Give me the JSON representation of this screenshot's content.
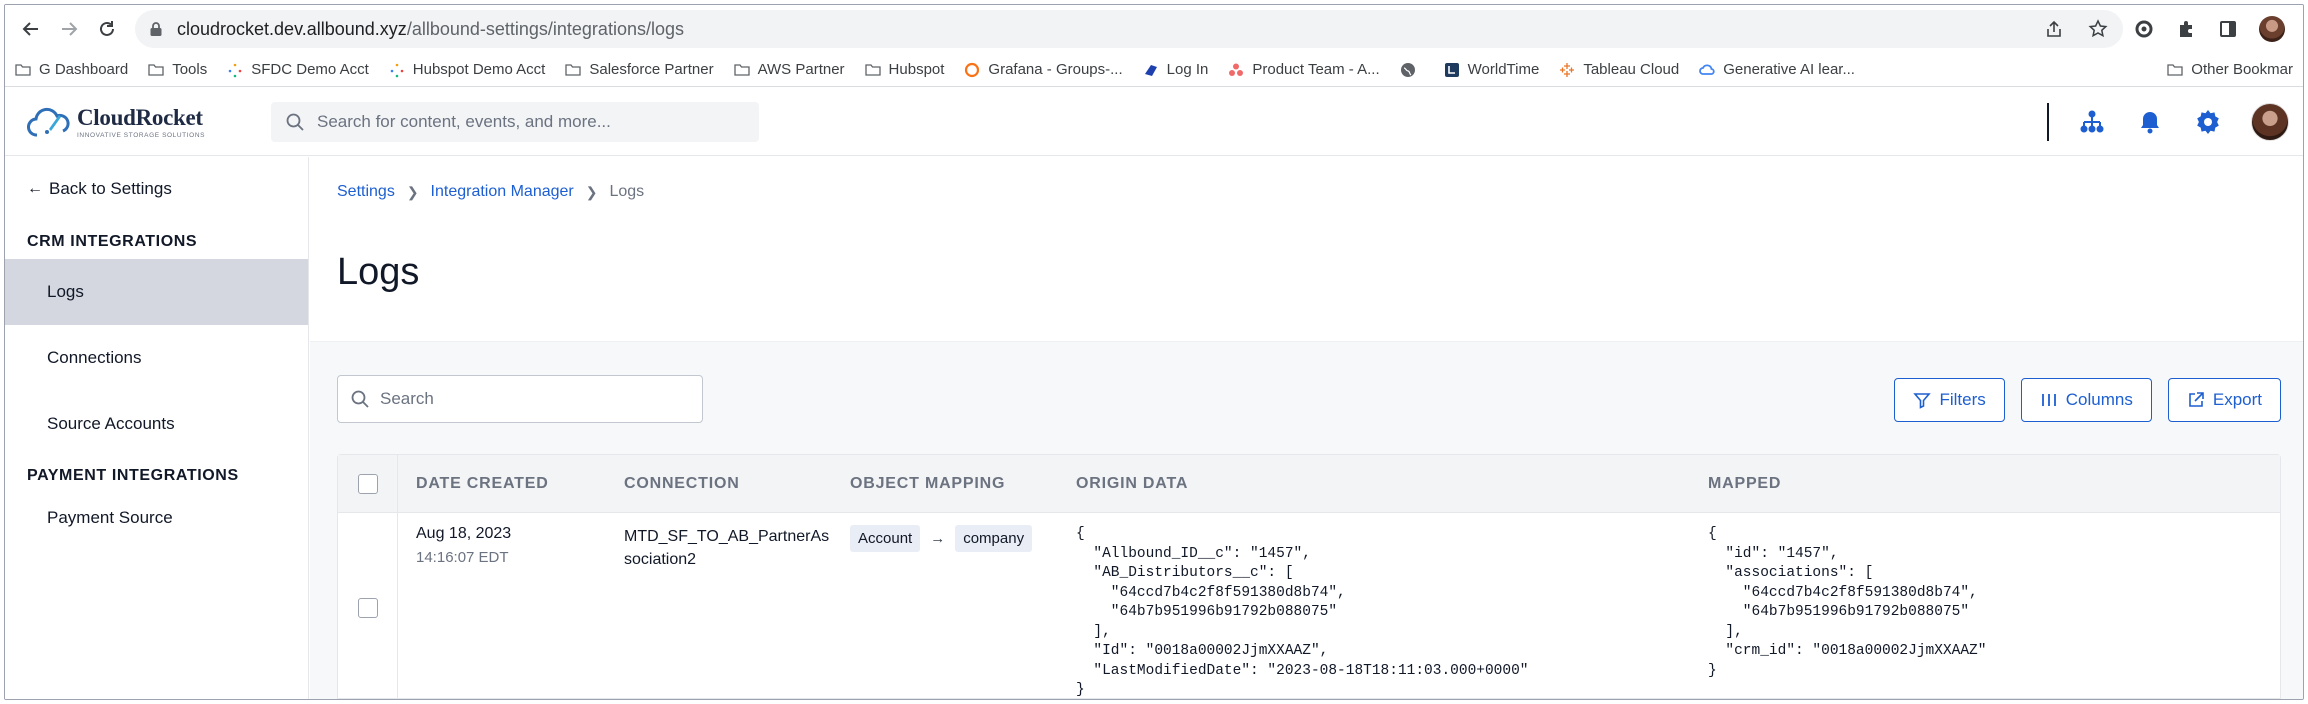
{
  "browser": {
    "url_host": "cloudrocket.dev.allbound.xyz",
    "url_path": "/allbound-settings/integrations/logs",
    "bookmarks": [
      {
        "label": "G Dashboard",
        "icon": "folder-icon"
      },
      {
        "label": "Tools",
        "icon": "folder-icon"
      },
      {
        "label": "SFDC Demo Acct",
        "icon": "sparkle-icon"
      },
      {
        "label": "Hubspot Demo Acct",
        "icon": "sparkle-icon"
      },
      {
        "label": "Salesforce Partner",
        "icon": "folder-icon"
      },
      {
        "label": "AWS Partner",
        "icon": "folder-icon"
      },
      {
        "label": "Hubspot",
        "icon": "folder-icon"
      },
      {
        "label": "Grafana - Groups-...",
        "icon": "grafana-icon"
      },
      {
        "label": "Log In",
        "icon": "login-icon"
      },
      {
        "label": "Product Team - A...",
        "icon": "asana-icon"
      },
      {
        "label": "",
        "icon": "globe-icon"
      },
      {
        "label": "WorldTime",
        "icon": "worldtime-icon"
      },
      {
        "label": "Tableau Cloud",
        "icon": "tableau-icon"
      },
      {
        "label": "Generative AI lear...",
        "icon": "google-cloud-icon"
      }
    ],
    "other_bookmarks": "Other Bookmar"
  },
  "header": {
    "brand_name": "CloudRocket",
    "brand_tagline": "INNOVATIVE STORAGE SOLUTIONS",
    "search_placeholder": "Search for content, events, and more..."
  },
  "sidebar": {
    "back_label": "Back to Settings",
    "crm_title": "CRM INTEGRATIONS",
    "crm_items": [
      "Logs",
      "Connections",
      "Source Accounts"
    ],
    "payment_title": "PAYMENT INTEGRATIONS",
    "payment_items": [
      "Payment Source"
    ]
  },
  "breadcrumb": {
    "items": [
      "Settings",
      "Integration Manager",
      "Logs"
    ]
  },
  "page": {
    "title": "Logs",
    "search_placeholder": "Search",
    "filters_label": "Filters",
    "columns_label": "Columns",
    "export_label": "Export"
  },
  "table": {
    "headers": [
      "DATE CREATED",
      "CONNECTION",
      "OBJECT MAPPING",
      "ORIGIN DATA",
      "MAPPED"
    ],
    "rows": [
      {
        "date": "Aug 18, 2023",
        "time": "14:16:07 EDT",
        "connection": "MTD_SF_TO_AB_PartnerAssociation2",
        "map_from": "Account",
        "map_to": "company",
        "origin_data": "{\n  \"Allbound_ID__c\": \"1457\",\n  \"AB_Distributors__c\": [\n    \"64ccd7b4c2f8f591380d8b74\",\n    \"64b7b951996b91792b088075\"\n  ],\n  \"Id\": \"0018a00002JjmXXAAZ\",\n  \"LastModifiedDate\": \"2023-08-18T18:11:03.000+0000\"\n}",
        "mapped": "{\n  \"id\": \"1457\",\n  \"associations\": [\n    \"64ccd7b4c2f8f591380d8b74\",\n    \"64b7b951996b91792b088075\"\n  ],\n  \"crm_id\": \"0018a00002JjmXXAAZ\"\n}"
      }
    ]
  },
  "colors": {
    "accent": "#1d5fd1",
    "header_icons": "#1d5fd1",
    "sidebar_active": "#d4d7df"
  }
}
